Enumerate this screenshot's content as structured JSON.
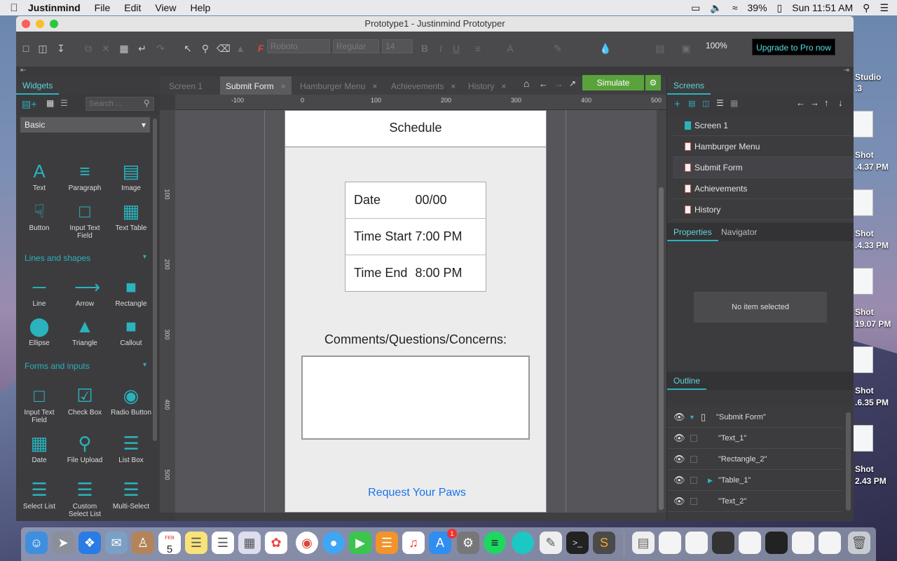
{
  "menubar": {
    "app": "Justinmind",
    "items": [
      "File",
      "Edit",
      "View",
      "Help"
    ],
    "battery": "39%",
    "clock": "Sun 11:51 AM"
  },
  "window": {
    "title": "Prototype1 - Justinmind Prototyper"
  },
  "toolbar": {
    "font": "Roboto",
    "weight": "Regular",
    "size": "14",
    "zoom": "100%",
    "upgrade": "Upgrade to Pro now"
  },
  "left_panel": {
    "tab": "Widgets",
    "search_placeholder": "Search ...",
    "category": "Basic",
    "basic": [
      "Text",
      "Paragraph",
      "Image",
      "Button",
      "Input Text Field",
      "Text Table"
    ],
    "lines_title": "Lines and shapes",
    "lines": [
      "Line",
      "Arrow",
      "Rectangle",
      "Ellipse",
      "Triangle",
      "Callout"
    ],
    "forms_title": "Forms and inputs",
    "forms": [
      "Input Text Field",
      "Check Box",
      "Radio Button",
      "Date",
      "File Upload",
      "List Box",
      "Select List",
      "Custom Select List",
      "Multi-Select"
    ]
  },
  "doc_tabs": [
    "Screen 1",
    "Submit Form",
    "Hamburger Menu",
    "Achievements",
    "History"
  ],
  "simulate": "Simulate",
  "ruler_h": [
    "-100",
    "0",
    "100",
    "200",
    "300",
    "400",
    "500"
  ],
  "ruler_v": [
    "100",
    "200",
    "300",
    "400",
    "500"
  ],
  "canvas": {
    "header": "Schedule",
    "table": [
      [
        "Date",
        "00/00"
      ],
      [
        "Time Start",
        "7:00 PM"
      ],
      [
        "Time End",
        "8:00 PM"
      ]
    ],
    "comments_label": "Comments/Questions/Concerns:",
    "link": "Request Your Paws"
  },
  "screens": {
    "tab": "Screens",
    "items": [
      "Screen 1",
      "Hamburger Menu",
      "Submit Form",
      "Achievements",
      "History"
    ]
  },
  "properties": {
    "tab": "Properties",
    "tab2": "Navigator",
    "empty": "No item selected"
  },
  "outline": {
    "tab": "Outline",
    "items": [
      "\"Submit Form\"",
      "\"Text_1\"",
      "\"Rectangle_2\"",
      "\"Table_1\"",
      "\"Text_2\""
    ]
  },
  "desktop": {
    "studio": "Studio",
    "studio_sub": ".3",
    "shots": [
      "Shot",
      "Shot",
      "Shot",
      "Shot",
      "Shot"
    ],
    "shot_times": [
      ".4.37 PM",
      ".4.33 PM",
      "19.07 PM",
      ".6.35 PM",
      "2.43 PM"
    ]
  },
  "dock": {
    "calendar_month": "FEB",
    "calendar_day": "5",
    "badge": "1"
  }
}
